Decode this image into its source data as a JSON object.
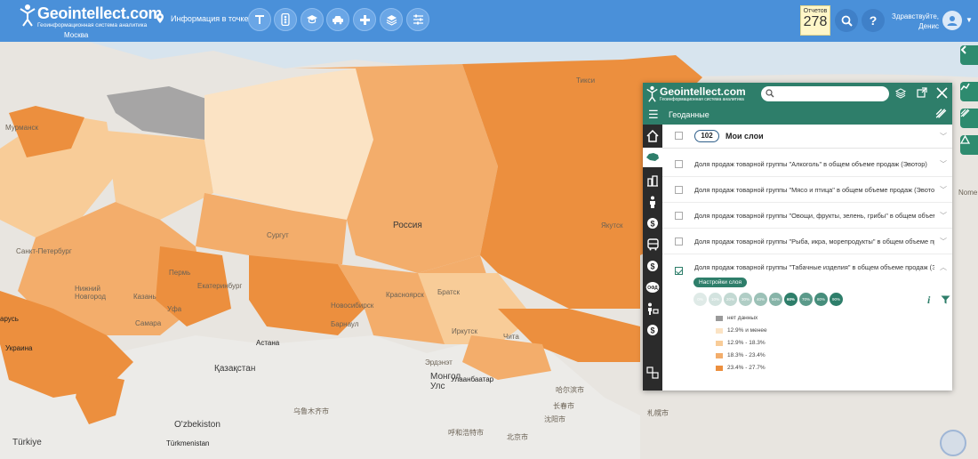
{
  "app": {
    "logo_name": "Geointellect.com",
    "logo_reg": "®",
    "logo_subtitle": "Геоинформационная система аналитика",
    "city": "Москва"
  },
  "header": {
    "info_point_label": "Информация в точке",
    "tool_icons": [
      "text-tool-icon",
      "traffic-light-icon",
      "education-icon",
      "cars-icon",
      "pharmacy-icon",
      "layers-icon",
      "sliders-icon"
    ],
    "reports_label": "Отчетов",
    "reports_count": "278",
    "search_icon": "search-icon",
    "help_label": "?",
    "greeting_line1": "Здравствуйте,",
    "greeting_line2": "Денис"
  },
  "map": {
    "labels": [
      {
        "id": "tiksi",
        "text": "Тикси"
      },
      {
        "id": "murmansk",
        "text": "Мурманск"
      },
      {
        "id": "spb",
        "text": "Санкт-Петербург"
      },
      {
        "id": "surgut",
        "text": "Сургут"
      },
      {
        "id": "russia",
        "text": "Россия"
      },
      {
        "id": "yakutsk",
        "text": "Якутск"
      },
      {
        "id": "perm",
        "text": "Пермь"
      },
      {
        "id": "ekb",
        "text": "Екатеринбург"
      },
      {
        "id": "nnovgorod",
        "text": "Нижний Новгород"
      },
      {
        "id": "kazan",
        "text": "Казань"
      },
      {
        "id": "samara",
        "text": "Самара"
      },
      {
        "id": "ufa",
        "text": "Уфа"
      },
      {
        "id": "krasnoyarsk",
        "text": "Красноярск"
      },
      {
        "id": "bratsk",
        "text": "Братск"
      },
      {
        "id": "novosibirsk",
        "text": "Новосибирск"
      },
      {
        "id": "barnaul",
        "text": "Барнаул"
      },
      {
        "id": "irkutsk",
        "text": "Иркутск"
      },
      {
        "id": "chita",
        "text": "Чита"
      },
      {
        "id": "astana",
        "text": "Астана"
      },
      {
        "id": "kazakhstan",
        "text": "Қазақстан"
      },
      {
        "id": "erdenet",
        "text": "Эрдэнэт"
      },
      {
        "id": "ulaanbaatar",
        "text": "Улаанбаатар"
      },
      {
        "id": "mongolia",
        "text": "Монгол Улс"
      },
      {
        "id": "uzbekistan",
        "text": "O'zbekiston"
      },
      {
        "id": "turkmenistan",
        "text": "Türkmenistan"
      },
      {
        "id": "ukraine",
        "text": "Украина"
      },
      {
        "id": "belarus",
        "text": "арусь"
      },
      {
        "id": "turkey",
        "text": "Türkiye"
      },
      {
        "id": "sapporo",
        "text": "札幌市"
      },
      {
        "id": "harbin",
        "text": "哈尔滨市"
      },
      {
        "id": "changchun",
        "text": "长春市"
      },
      {
        "id": "shenyang",
        "text": "沈阳市"
      },
      {
        "id": "beijing",
        "text": "北京市"
      },
      {
        "id": "hohhot",
        "text": "呼和浩特市"
      },
      {
        "id": "urumqi",
        "text": "乌鲁木齐市"
      },
      {
        "id": "nome",
        "text": "Nome"
      }
    ]
  },
  "panel": {
    "logo_name": "Geointellect.com",
    "logo_subtitle": "Геоинформационная система аналитика",
    "search_placeholder": "",
    "section_title": "Геоданные",
    "my_layers_count": "102",
    "my_layers_label": "Мои слои",
    "layers": [
      {
        "label": "Доля продаж товарной группы \"Алкоголь\" в общем объеме продаж (Эвотор)",
        "checked": false
      },
      {
        "label": "Доля продаж товарной группы \"Мясо и птица\" в общем объеме продаж (Эвотор)",
        "checked": false
      },
      {
        "label": "Доля продаж товарной группы \"Овощи, фрукты, зелень, грибы\" в общем объеме ...",
        "checked": false
      },
      {
        "label": "Доля продаж товарной группы \"Рыба, икра, морепродукты\" в общем объеме прод...",
        "checked": false
      },
      {
        "label": "Доля продаж товарной группы \"Табачные изделия\" в общем объеме продаж (Эво...",
        "checked": true
      }
    ],
    "settings_label": "Настройки слоя",
    "opacity_steps": [
      "0%",
      "10%",
      "20%",
      "30%",
      "40%",
      "50%",
      "60%",
      "70%",
      "80%",
      "90%"
    ],
    "opacity_selected": "60%",
    "legend": [
      {
        "label": "нет данных",
        "color": "#9a9a9a"
      },
      {
        "label": "12.9% и менее",
        "color": "#fbe3c4"
      },
      {
        "label": "12.9% - 18.3%",
        "color": "#f8cc98"
      },
      {
        "label": "18.3% - 23.4%",
        "color": "#f3ad6b"
      },
      {
        "label": "23.4% - 27.7%",
        "color": "#ec8f3e"
      }
    ]
  },
  "colors": {
    "header_bg": "#4a90d9",
    "panel_green": "#2e7e6a",
    "rail_dark": "#2b2b2b",
    "choropleth": [
      "#fbe3c4",
      "#f8cc98",
      "#f3ad6b",
      "#ec8f3e"
    ]
  }
}
